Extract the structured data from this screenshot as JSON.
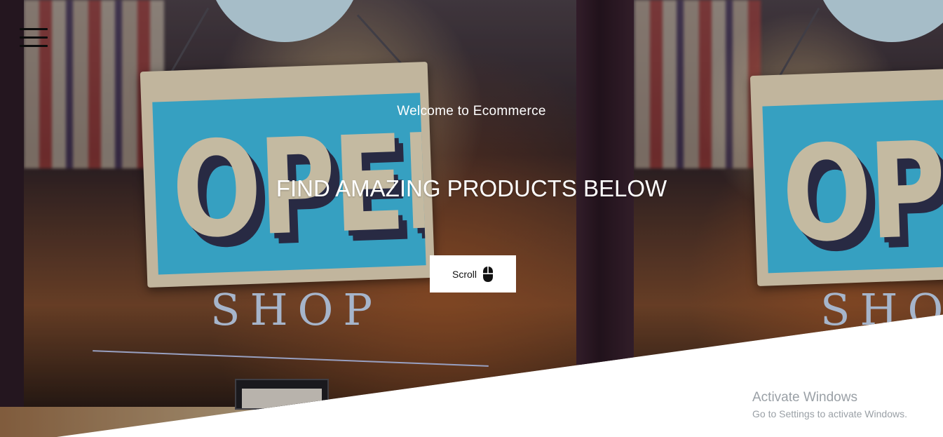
{
  "hero": {
    "welcome_text": "Welcome to Ecommerce",
    "headline": "FIND AMAZING PRODUCTS BELOW",
    "scroll_label": "Scroll",
    "sign_text": "OPEN",
    "window_text": "SHOP"
  },
  "nav": {
    "menu_icon": "hamburger-menu-icon"
  },
  "icons": {
    "scroll": "mouse-icon"
  },
  "watermark": {
    "title": "Activate Windows",
    "subtitle": "Go to Settings to activate Windows."
  },
  "colors": {
    "sign_blue": "#40c2ea",
    "text_light": "#ffffff",
    "button_bg": "#ffffff",
    "watermark": "#9aa0a6"
  }
}
